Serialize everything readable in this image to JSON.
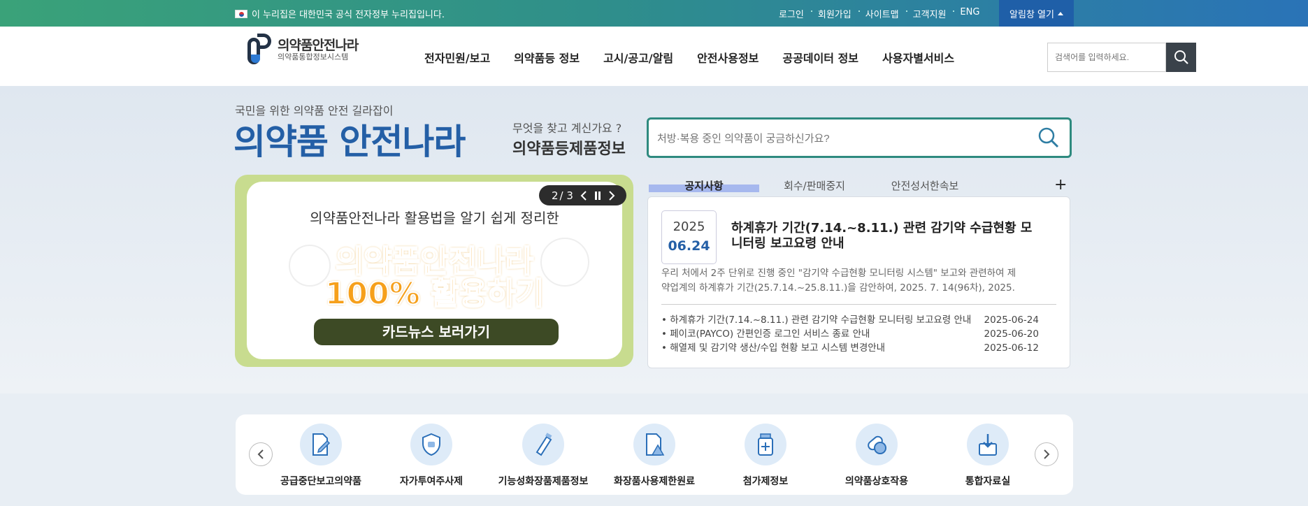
{
  "topbar": {
    "gov_note": "이 누리집은 대한민국 공식 전자정부 누리집입니다.",
    "links": [
      "로그인",
      "회원가입",
      "사이트맵",
      "고객지원",
      "ENG"
    ],
    "alarm_label": "알림창 열기"
  },
  "header": {
    "logo_title": "의약품안전나라",
    "logo_sub": "의약품통합정보시스템",
    "nav": [
      "전자민원/보고",
      "의약품등 정보",
      "고시/공고/알림",
      "안전사용정보",
      "공공데이터 정보",
      "사용자별서비스"
    ],
    "search_placeholder": "검색어를 입력하세요."
  },
  "hero": {
    "subtitle": "국민을 위한 의약품 안전 길라잡이",
    "title": "의약품 안전나라",
    "question": "무엇을 찾고 계신가요 ?",
    "category": "의약품등제품정보",
    "search_placeholder": "처방·복용 중인 의약품이 궁금하신가요?"
  },
  "banner": {
    "line1": "의약품안전나라 활용법을 알기 쉽게 정리한",
    "big1": "의약품안전나라",
    "big2": "100% 활용하기",
    "button": "카드뉴스 보러가기",
    "page_current": "2",
    "page_total": "/ 3"
  },
  "notice": {
    "tabs": [
      "공지사항",
      "회수/판매중지",
      "안전성서한속보"
    ],
    "featured": {
      "year": "2025",
      "date": "06.24",
      "title": "하계휴가 기간(7.14.~8.11.) 관련 감기약 수급현황 모니터링 보고요령 안내",
      "desc": "우리 처에서 2주 단위로 진행 중인 \"감기약 수급현황 모니터링 시스템\" 보고와 관련하여 제약업계의 하계휴가 기간(25.7.14.~25.8.11.)을 감안하여,   2025. 7. 14(96차), 2025. 7.…"
    },
    "list": [
      {
        "title": "하계휴가 기간(7.14.~8.11.) 관련 감기약 수급현황 모니터링 보고요령 안내",
        "date": "2025-06-24"
      },
      {
        "title": "페이코(PAYCO) 간편인증 로그인 서비스 종료 안내",
        "date": "2025-06-20"
      },
      {
        "title": "해열제 및 감기약 생산/수입 현황 보고 시스템 변경안내",
        "date": "2025-06-12"
      }
    ]
  },
  "quick": {
    "items": [
      "공급중단보고의약품",
      "자가투여주사제",
      "기능성화장품제품정보",
      "화장품사용제한원료",
      "첨가제정보",
      "의약품상호작용",
      "통합자료실"
    ]
  }
}
